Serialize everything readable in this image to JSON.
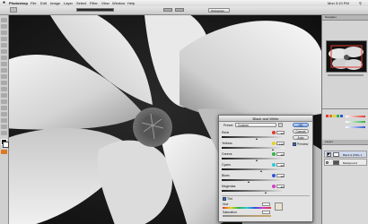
{
  "menubar": {
    "app_name": "Photoshop",
    "items": [
      "File",
      "Edit",
      "Image",
      "Layer",
      "Select",
      "Filter",
      "View",
      "Window",
      "Help"
    ],
    "clock": "Mon 3:10 PM"
  },
  "optionsbar": {
    "workspace_label": "Workspace"
  },
  "dialog": {
    "title": "Black and White",
    "preset_label": "Preset:",
    "preset_value": "Custom",
    "ok_label": "OK",
    "cancel_label": "Cancel",
    "auto_label": "Auto",
    "preview_label": "Preview",
    "tint_label": "Tint",
    "hue_label": "Hue",
    "saturation_label": "Saturation",
    "sliders": [
      {
        "label": "Reds",
        "value": "40",
        "percent": "%",
        "color": "#e03a2f",
        "level": 0.55
      },
      {
        "label": "Yellows",
        "value": "120",
        "percent": "%",
        "color": "#e6d21d",
        "level": 0.82
      },
      {
        "label": "Greens",
        "value": "40",
        "percent": "%",
        "color": "#2fb34a",
        "level": 0.55
      },
      {
        "label": "Cyans",
        "value": "60",
        "percent": "%",
        "color": "#2ec7d8",
        "level": 0.62
      },
      {
        "label": "Blues",
        "value": "20",
        "percent": "%",
        "color": "#2f56d8",
        "level": 0.42
      },
      {
        "label": "Magentas",
        "value": "80",
        "percent": "%",
        "color": "#d83ac9",
        "level": 0.7
      }
    ]
  },
  "panels": {
    "navigator_tab": "Navigator",
    "layers_tab": "Layers",
    "layers": [
      {
        "name": "Black & White 1"
      },
      {
        "name": "Background"
      }
    ]
  }
}
